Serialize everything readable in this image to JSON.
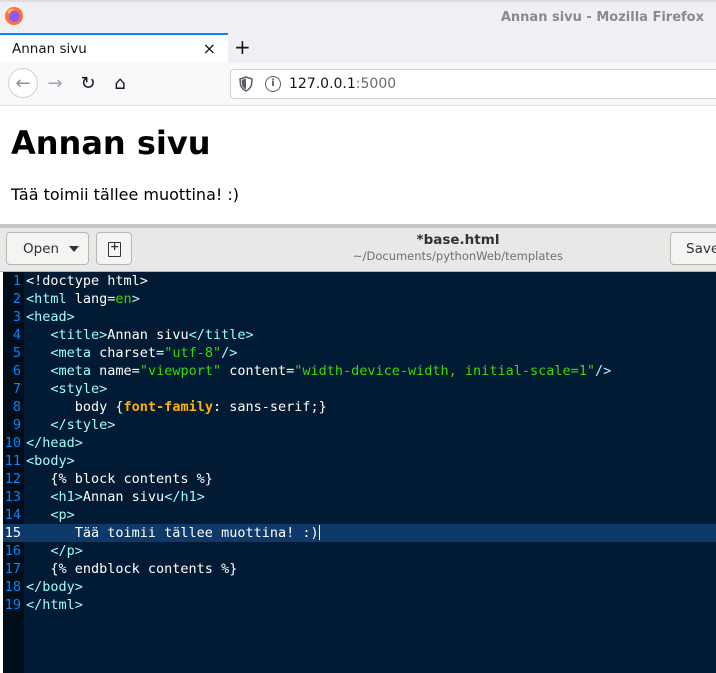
{
  "firefox": {
    "window_title": "Annan sivu - Mozilla Firefox",
    "tab": {
      "title": "Annan sivu",
      "close": "×"
    },
    "new_tab": "+",
    "nav": {
      "back": "←",
      "forward": "→",
      "reload": "↻",
      "home": "⌂"
    },
    "url": {
      "host": "127.0.0.1",
      "port": ":5000"
    },
    "page": {
      "heading": "Annan sivu",
      "paragraph": "Tää toimii tällee muottina! :)"
    }
  },
  "gedit": {
    "open_label": "Open",
    "save_label": "Save",
    "file_name": "*base.html",
    "file_path": "~/Documents/pythonWeb/templates",
    "current_line": 15,
    "lines": [
      {
        "n": "1",
        "tokens": [
          {
            "t": "<!doctype html>",
            "c": "plain"
          }
        ]
      },
      {
        "n": "2",
        "tokens": [
          {
            "t": "<html",
            "c": "tag"
          },
          {
            "t": " lang=",
            "c": "attr"
          },
          {
            "t": "en",
            "c": "str"
          },
          {
            "t": ">",
            "c": "tag"
          }
        ]
      },
      {
        "n": "3",
        "tokens": [
          {
            "t": "<head>",
            "c": "tag"
          }
        ]
      },
      {
        "n": "4",
        "tokens": [
          {
            "t": "   ",
            "c": "plain"
          },
          {
            "t": "<title>",
            "c": "tag"
          },
          {
            "t": "Annan sivu",
            "c": "plain"
          },
          {
            "t": "</title>",
            "c": "tag"
          }
        ]
      },
      {
        "n": "5",
        "tokens": [
          {
            "t": "   ",
            "c": "plain"
          },
          {
            "t": "<meta",
            "c": "tag"
          },
          {
            "t": " charset=",
            "c": "attr"
          },
          {
            "t": "\"utf-8\"",
            "c": "str"
          },
          {
            "t": "/>",
            "c": "tag"
          }
        ]
      },
      {
        "n": "6",
        "tokens": [
          {
            "t": "   ",
            "c": "plain"
          },
          {
            "t": "<meta",
            "c": "tag"
          },
          {
            "t": " name=",
            "c": "attr"
          },
          {
            "t": "\"viewport\"",
            "c": "str"
          },
          {
            "t": " content=",
            "c": "attr"
          },
          {
            "t": "\"width-device-width, initial-scale=1\"",
            "c": "str"
          },
          {
            "t": "/>",
            "c": "tag"
          }
        ]
      },
      {
        "n": "7",
        "tokens": [
          {
            "t": "   ",
            "c": "plain"
          },
          {
            "t": "<style>",
            "c": "tag"
          }
        ]
      },
      {
        "n": "8",
        "tokens": [
          {
            "t": "      body {",
            "c": "plain"
          },
          {
            "t": "font-family",
            "c": "kw"
          },
          {
            "t": ": sans-serif;}",
            "c": "plain"
          }
        ]
      },
      {
        "n": "9",
        "tokens": [
          {
            "t": "   ",
            "c": "plain"
          },
          {
            "t": "</style>",
            "c": "tag"
          }
        ]
      },
      {
        "n": "10",
        "tokens": [
          {
            "t": "</head>",
            "c": "tag"
          }
        ]
      },
      {
        "n": "11",
        "tokens": [
          {
            "t": "<body>",
            "c": "tag"
          }
        ]
      },
      {
        "n": "12",
        "tokens": [
          {
            "t": "   {% block contents %}",
            "c": "plain"
          }
        ]
      },
      {
        "n": "13",
        "tokens": [
          {
            "t": "   ",
            "c": "plain"
          },
          {
            "t": "<h1>",
            "c": "tag"
          },
          {
            "t": "Annan sivu",
            "c": "plain"
          },
          {
            "t": "</h1>",
            "c": "tag"
          }
        ]
      },
      {
        "n": "14",
        "tokens": [
          {
            "t": "   ",
            "c": "plain"
          },
          {
            "t": "<p>",
            "c": "tag"
          }
        ]
      },
      {
        "n": "15",
        "tokens": [
          {
            "t": "      Tää toimii tällee muottina! :)",
            "c": "plain"
          }
        ]
      },
      {
        "n": "16",
        "tokens": [
          {
            "t": "   ",
            "c": "plain"
          },
          {
            "t": "</p>",
            "c": "tag"
          }
        ]
      },
      {
        "n": "17",
        "tokens": [
          {
            "t": "   {% endblock contents %}",
            "c": "plain"
          }
        ]
      },
      {
        "n": "18",
        "tokens": [
          {
            "t": "</body>",
            "c": "tag"
          }
        ]
      },
      {
        "n": "19",
        "tokens": [
          {
            "t": "</html>",
            "c": "tag"
          }
        ]
      }
    ]
  }
}
